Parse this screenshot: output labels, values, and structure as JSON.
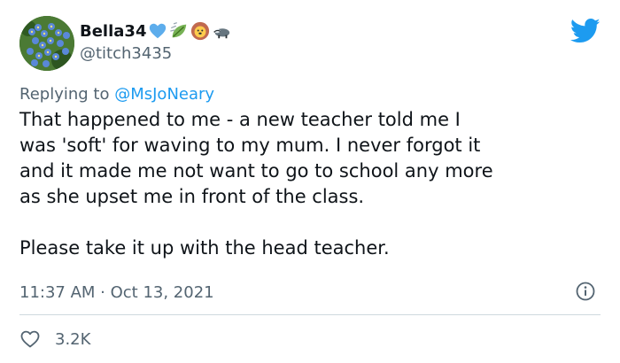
{
  "tweet": {
    "display_name": "Bella34",
    "emojis": [
      "blue-heart-icon",
      "leaf-fluttering-icon",
      "lion-face-icon",
      "badger-icon"
    ],
    "handle": "@titch3435",
    "reply_prefix": "Replying to",
    "reply_to": "@MsJoNeary",
    "text_lines": [
      "That happened to me - a new teacher told me I",
      "was 'soft' for waving to my mum. I never forgot it",
      "and it made me not want to go to school any more",
      "as she upset me in front of the class.",
      "Please take it up with the head teacher."
    ],
    "timestamp": "11:37 AM · Oct 13, 2021",
    "like_count": "3.2K"
  },
  "colors": {
    "brand_blue": "#1d9bf0",
    "text_primary": "#0f1419",
    "text_secondary": "#536471",
    "divider": "#cfd9de"
  }
}
